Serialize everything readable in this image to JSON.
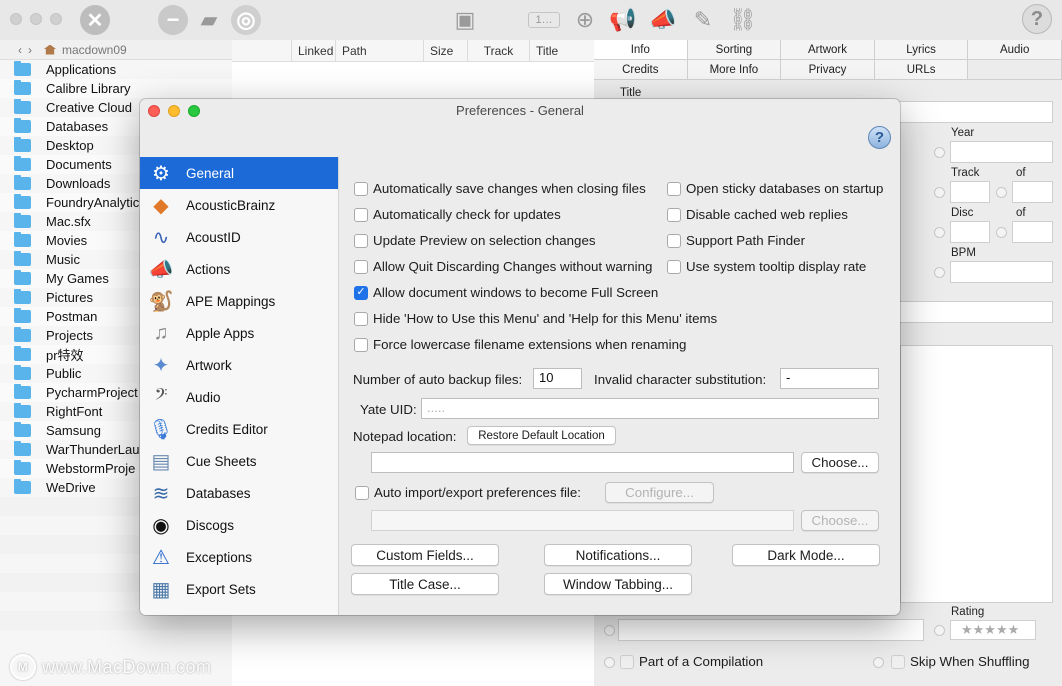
{
  "finder": {
    "path": "macdown09",
    "folders": [
      "Applications",
      "Calibre Library",
      "Creative Cloud",
      "Databases",
      "Desktop",
      "Documents",
      "Downloads",
      "FoundryAnalytic",
      "Mac.sfx",
      "Movies",
      "Music",
      "My Games",
      "Pictures",
      "Postman",
      "Projects",
      "pr特效",
      "Public",
      "PycharmProject",
      "RightFont",
      "Samsung",
      "WarThunderLau",
      "WebstormProje",
      "WeDrive"
    ]
  },
  "file_table": {
    "columns": [
      "Linked",
      "Path",
      "Size",
      "Track",
      "Title"
    ]
  },
  "tag_panel": {
    "tabs_row1": [
      "Info",
      "Sorting",
      "Artwork",
      "Lyrics",
      "Audio"
    ],
    "tabs_row2": [
      "Credits",
      "More Info",
      "Privacy",
      "URLs"
    ],
    "labels": {
      "title": "Title",
      "year": "Year",
      "track": "Track",
      "of1": "of",
      "disc": "Disc",
      "of2": "of",
      "bpm": "BPM",
      "rating": "Rating",
      "compilation": "Part of a Compilation",
      "shuffle": "Skip When Shuffling",
      "rating_stars": "★★★★★"
    }
  },
  "watermark": {
    "logo": "M",
    "text": "www.MacDown.com"
  },
  "dialog": {
    "title": "Preferences - General",
    "help": "?",
    "sidebar": [
      {
        "label": "General",
        "icon": "⚙"
      },
      {
        "label": "AcousticBrainz",
        "icon": "◆"
      },
      {
        "label": "AcoustID",
        "icon": "∿"
      },
      {
        "label": "Actions",
        "icon": "📣"
      },
      {
        "label": "APE Mappings",
        "icon": "🐒"
      },
      {
        "label": "Apple Apps",
        "icon": "♫"
      },
      {
        "label": "Artwork",
        "icon": "✦"
      },
      {
        "label": "Audio",
        "icon": "𝄢"
      },
      {
        "label": "Credits Editor",
        "icon": "🎙"
      },
      {
        "label": "Cue Sheets",
        "icon": "▤"
      },
      {
        "label": "Databases",
        "icon": "≋"
      },
      {
        "label": "Discogs",
        "icon": "◉"
      },
      {
        "label": "Exceptions",
        "icon": "⚠"
      },
      {
        "label": "Export Sets",
        "icon": "▦"
      }
    ],
    "left_checks": [
      {
        "label": "Automatically save changes when closing files",
        "checked": false
      },
      {
        "label": "Automatically check for updates",
        "checked": false
      },
      {
        "label": "Update Preview on selection changes",
        "checked": false
      },
      {
        "label": "Allow Quit Discarding Changes without warning",
        "checked": false
      },
      {
        "label": "Allow document windows to become Full Screen",
        "checked": true
      },
      {
        "label": "Hide 'How to Use this Menu' and 'Help for this Menu' items",
        "checked": false
      },
      {
        "label": "Force lowercase filename extensions when renaming",
        "checked": false
      }
    ],
    "right_checks": [
      {
        "label": "Open sticky databases on startup",
        "checked": false
      },
      {
        "label": "Disable cached web replies",
        "checked": false
      },
      {
        "label": "Support Path Finder",
        "checked": false
      },
      {
        "label": "Use system tooltip display rate",
        "checked": false
      }
    ],
    "backup_label": "Number of auto backup files:",
    "backup_value": "10",
    "invalid_label": "Invalid character substitution:",
    "invalid_value": "-",
    "yate_uid_label": "Yate UID:",
    "yate_uid_placeholder": ".....",
    "notepad_label": "Notepad location:",
    "restore_button": "Restore Default Location",
    "notepad_path": "",
    "choose_button": "Choose...",
    "auto_import_label": "Auto import/export preferences file:",
    "configure_button": "Configure...",
    "import_path": "",
    "choose_disabled_button": "Choose...",
    "buttons": {
      "custom_fields": "Custom Fields...",
      "notifications": "Notifications...",
      "dark_mode": "Dark Mode...",
      "title_case": "Title Case...",
      "window_tabbing": "Window Tabbing..."
    }
  }
}
